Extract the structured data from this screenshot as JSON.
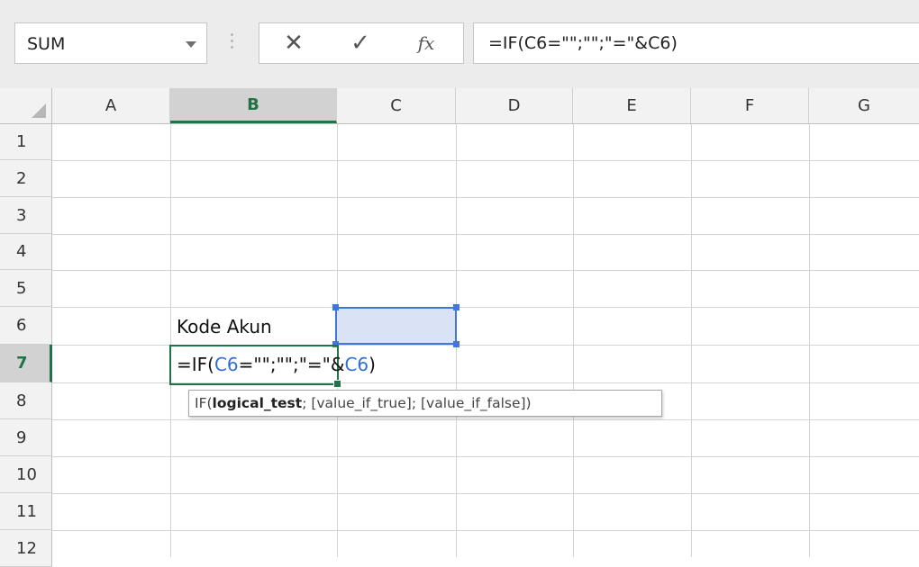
{
  "formula_bar": {
    "name_box": "SUM",
    "cancel_icon": "close-icon",
    "enter_icon": "check-icon",
    "fx_label": "fx",
    "formula": "=IF(C6=\"\";\"\";\"=\"&C6)"
  },
  "columns": [
    "A",
    "B",
    "C",
    "D",
    "E",
    "F",
    "G"
  ],
  "active_column": "B",
  "rows": [
    "1",
    "2",
    "3",
    "4",
    "5",
    "6",
    "7",
    "8",
    "9",
    "10",
    "11",
    "12"
  ],
  "active_row": "7",
  "cells": {
    "B6": "Kode Akun",
    "B7_part1": "=IF(",
    "B7_ref1": "C6",
    "B7_part2": "=\"\";\"\";\"=\"&",
    "B7_ref2": "C6",
    "B7_part3": ")"
  },
  "tooltip": {
    "fn": "IF(",
    "arg1": "logical_test",
    "rest": "; [value_if_true]; [value_if_false])"
  },
  "colors": {
    "accent_green": "#217346",
    "ref_blue": "#2f6fd6",
    "ref_fill": "#d9e3f5"
  }
}
